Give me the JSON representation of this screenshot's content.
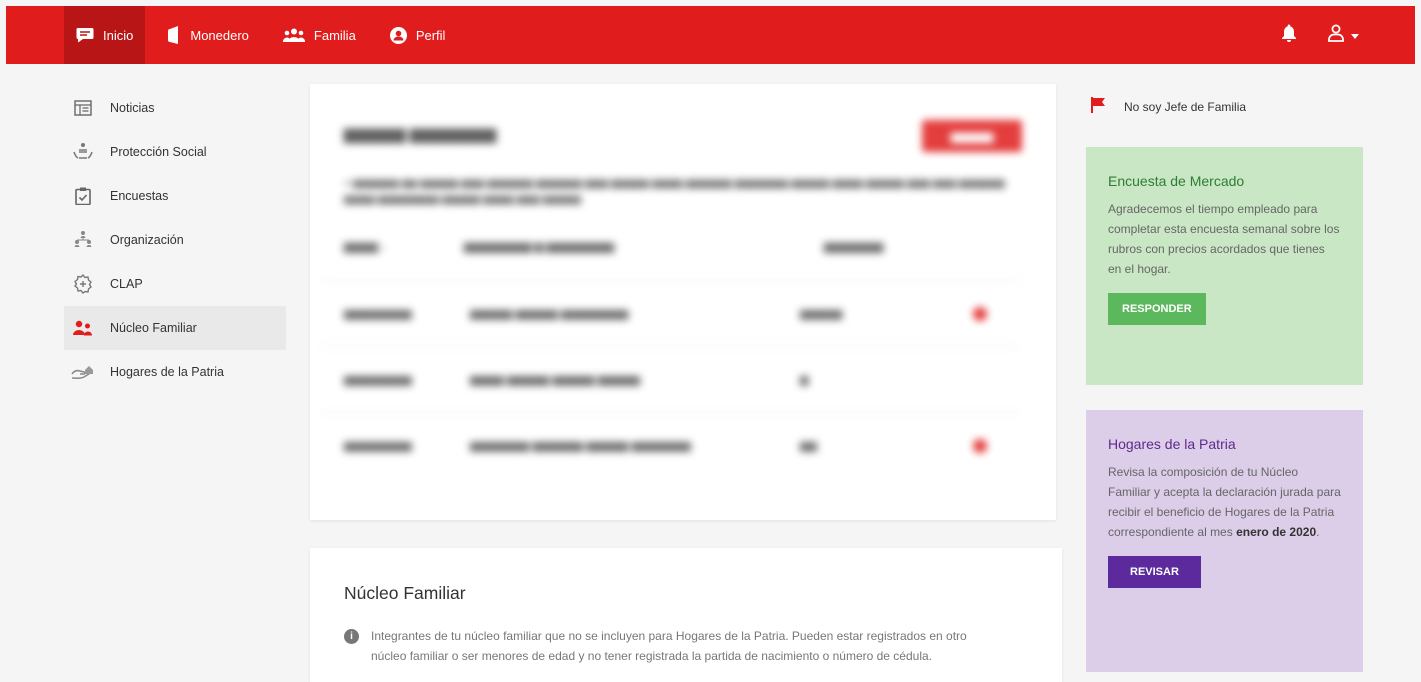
{
  "colors": {
    "brand_red": "#e01c1c",
    "green_panel": "#c9e7c4",
    "purple_panel": "#dccde9",
    "purple_button": "#5c2a9d",
    "green_button": "#5cb85c"
  },
  "topbar": {
    "tabs": [
      {
        "label": "Inicio",
        "icon": "chat-bubble-icon"
      },
      {
        "label": "Monedero",
        "icon": "wallet-icon"
      },
      {
        "label": "Familia",
        "icon": "group-icon"
      },
      {
        "label": "Perfil",
        "icon": "account-circle-icon"
      }
    ],
    "active_tab": "Inicio",
    "right_icons": [
      "bell-icon",
      "user-icon",
      "caret-down-icon"
    ]
  },
  "sidebar": {
    "items": [
      {
        "label": "Noticias",
        "icon": "newspaper-icon"
      },
      {
        "label": "Protección Social",
        "icon": "social-protection-icon"
      },
      {
        "label": "Encuestas",
        "icon": "clipboard-check-icon"
      },
      {
        "label": "Organización",
        "icon": "organization-icon"
      },
      {
        "label": "CLAP",
        "icon": "clap-icon"
      },
      {
        "label": "Núcleo Familiar",
        "icon": "family-icon"
      },
      {
        "label": "Hogares de la Patria",
        "icon": "home-hands-icon"
      }
    ],
    "active_item": "Núcleo Familiar"
  },
  "nucleo_card": {
    "title": "Núcleo Familiar",
    "info_text": "Integrantes de tu núcleo familiar que no se incluyen para Hogares de la Patria. Pueden estar registrados en otro núcleo familiar o ser menores de edad y no tener registrada la partida de nacimiento o número de cédula."
  },
  "right_panel": {
    "jefe_label": "No soy Jefe de Familia",
    "encuesta": {
      "title": "Encuesta de Mercado",
      "text": "Agradecemos el tiempo empleado para completar esta encuesta semanal sobre los rubros con precios acordados que tienes en el hogar.",
      "button": "RESPONDER"
    },
    "hogares": {
      "title": "Hogares de la Patria",
      "text": "Revisa la composición de tu Núcleo Familiar y acepta la declaración jurada para recibir el beneficio de Hogares de la Patria correspondiente al mes ",
      "bold_text": "enero de 2020",
      "suffix": ".",
      "button": "REVISAR"
    }
  }
}
